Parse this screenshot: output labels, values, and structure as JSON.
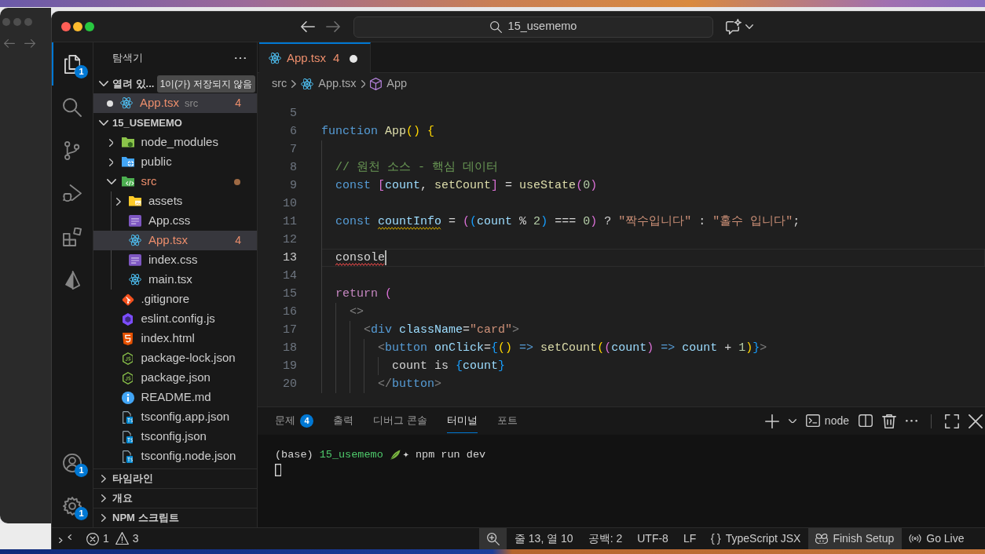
{
  "window": {
    "search": "15_usememo"
  },
  "activity_bar": {
    "top": [
      {
        "kind": "files",
        "selected": true,
        "badge": "1"
      },
      {
        "kind": "search",
        "selected": false
      },
      {
        "kind": "branch",
        "selected": false
      },
      {
        "kind": "debug",
        "selected": false
      },
      {
        "kind": "extensions",
        "selected": false
      },
      {
        "kind": "prism",
        "selected": false
      }
    ],
    "bottom": [
      {
        "kind": "account",
        "selected": false,
        "badge": "1"
      },
      {
        "kind": "gear",
        "selected": false,
        "badge": "1"
      }
    ]
  },
  "sidebar": {
    "title": "탐색기",
    "open_editors": {
      "label": "열려 있...",
      "expanded": true,
      "badge": "1이(가) 저장되지 않음",
      "items": [
        {
          "kind": "react",
          "name": "App.tsx",
          "description": "src",
          "problems": "4",
          "dirty": true,
          "error": true,
          "selected": true
        }
      ]
    },
    "project": {
      "label": "15_USEMEMO",
      "expanded": true,
      "items": [
        {
          "kind": "modules",
          "name": "node_modules",
          "expanded": false,
          "selected": false,
          "error": false,
          "dot": false
        },
        {
          "kind": "web",
          "name": "public",
          "expanded": false,
          "selected": false,
          "error": false,
          "dot": false
        },
        {
          "kind": "source",
          "name": "src",
          "expanded": true,
          "selected": false,
          "error": true,
          "dot": true,
          "children": [
            {
              "kind": "assets",
              "name": "assets",
              "expanded": false,
              "selected": false,
              "error": false,
              "dot": false
            },
            {
              "kind": "css",
              "name": "App.css",
              "selected": false,
              "error": false,
              "dot": false
            },
            {
              "kind": "react",
              "name": "App.tsx",
              "problems": "4",
              "selected": true,
              "error": true,
              "dot": false
            },
            {
              "kind": "css",
              "name": "index.css",
              "selected": false,
              "error": false,
              "dot": false
            },
            {
              "kind": "react",
              "name": "main.tsx",
              "selected": false,
              "error": false,
              "dot": false
            }
          ]
        },
        {
          "kind": "git",
          "name": ".gitignore",
          "selected": false,
          "error": false,
          "dot": false
        },
        {
          "kind": "eslint",
          "name": "eslint.config.js",
          "selected": false,
          "error": false,
          "dot": false
        },
        {
          "kind": "html",
          "name": "index.html",
          "selected": false,
          "error": false,
          "dot": false
        },
        {
          "kind": "js",
          "name": "package-lock.json",
          "selected": false,
          "error": false,
          "dot": false
        },
        {
          "kind": "js",
          "name": "package.json",
          "selected": false,
          "error": false,
          "dot": false
        },
        {
          "kind": "info",
          "name": "README.md",
          "selected": false,
          "error": false,
          "dot": false
        },
        {
          "kind": "typescript",
          "name": "tsconfig.app.json",
          "selected": false,
          "error": false,
          "dot": false
        },
        {
          "kind": "typescript",
          "name": "tsconfig.json",
          "selected": false,
          "error": false,
          "dot": false
        },
        {
          "kind": "typescript",
          "name": "tsconfig.node.json",
          "selected": false,
          "error": false,
          "dot": false
        }
      ]
    },
    "sections": [
      {
        "label": "타임라인",
        "expanded": false
      },
      {
        "label": "개요",
        "expanded": false
      },
      {
        "label": "NPM 스크립트",
        "expanded": false
      }
    ]
  },
  "editor": {
    "tabs": [
      {
        "kind": "react",
        "label": "App.tsx",
        "problems": "4",
        "dirty": true,
        "error": true,
        "selected": true
      }
    ],
    "breadcrumbs": [
      {
        "kind": "folder",
        "text": "src"
      },
      {
        "kind": "react",
        "text": "App.tsx"
      },
      {
        "kind": "symbol",
        "text": "App"
      }
    ],
    "lines": [
      {
        "number": "5",
        "current": false
      },
      {
        "number": "6",
        "current": false,
        "tokens": [
          {
            "text": "function ",
            "kind": "keyword"
          },
          {
            "text": "App",
            "kind": "function"
          },
          {
            "text": "()",
            "kind": "bracket1"
          },
          {
            "text": " {",
            "kind": "bracket1"
          }
        ]
      },
      {
        "number": "7",
        "current": false
      },
      {
        "number": "8",
        "current": false,
        "tokens": [
          {
            "text": "  // 원천 소스 - 핵심 데이터",
            "kind": "comment"
          }
        ]
      },
      {
        "number": "9",
        "current": false,
        "tokens": [
          {
            "text": "  const ",
            "kind": "keyword"
          },
          {
            "text": "[",
            "kind": "bracket2"
          },
          {
            "text": "count",
            "kind": "variable"
          },
          {
            "text": ", ",
            "kind": "plain"
          },
          {
            "text": "setCount",
            "kind": "function"
          },
          {
            "text": "]",
            "kind": "bracket2"
          },
          {
            "text": " = ",
            "kind": "plain"
          },
          {
            "text": "useState",
            "kind": "function"
          },
          {
            "text": "(",
            "kind": "bracket2"
          },
          {
            "text": "0",
            "kind": "number"
          },
          {
            "text": ")",
            "kind": "bracket2"
          }
        ]
      },
      {
        "number": "10",
        "current": false
      },
      {
        "number": "11",
        "current": false,
        "tokens": [
          {
            "text": "  const ",
            "kind": "keyword"
          },
          {
            "text": "countInfo",
            "kind": "variable",
            "warning": true
          },
          {
            "text": " = ",
            "kind": "plain"
          },
          {
            "text": "(",
            "kind": "bracket2"
          },
          {
            "text": "(",
            "kind": "bracket3"
          },
          {
            "text": "count",
            "kind": "variable"
          },
          {
            "text": " % ",
            "kind": "plain"
          },
          {
            "text": "2",
            "kind": "number"
          },
          {
            "text": ")",
            "kind": "bracket3"
          },
          {
            "text": " === ",
            "kind": "plain"
          },
          {
            "text": "0",
            "kind": "number"
          },
          {
            "text": ")",
            "kind": "bracket2"
          },
          {
            "text": " ? ",
            "kind": "plain"
          },
          {
            "text": "\"짝수입니다\"",
            "kind": "string"
          },
          {
            "text": " : ",
            "kind": "plain"
          },
          {
            "text": "\"홀수 입니다\"",
            "kind": "string"
          },
          {
            "text": ";",
            "kind": "plain"
          }
        ]
      },
      {
        "number": "12",
        "current": false
      },
      {
        "number": "13",
        "current": true,
        "tokens": [
          {
            "text": "  console",
            "kind": "plain",
            "error": true
          }
        ]
      },
      {
        "number": "14",
        "current": false
      },
      {
        "number": "15",
        "current": false,
        "tokens": [
          {
            "text": "  return ",
            "kind": "control"
          },
          {
            "text": "(",
            "kind": "bracket2"
          }
        ]
      },
      {
        "number": "16",
        "current": false,
        "tokens": [
          {
            "text": "    <>",
            "kind": "tag"
          }
        ]
      },
      {
        "number": "17",
        "current": false,
        "tokens": [
          {
            "text": "      <",
            "kind": "tag"
          },
          {
            "text": "div ",
            "kind": "keyword"
          },
          {
            "text": "className",
            "kind": "variable"
          },
          {
            "text": "=",
            "kind": "plain"
          },
          {
            "text": "\"card\"",
            "kind": "string"
          },
          {
            "text": ">",
            "kind": "tag"
          }
        ]
      },
      {
        "number": "18",
        "current": false,
        "tokens": [
          {
            "text": "        <",
            "kind": "tag"
          },
          {
            "text": "button ",
            "kind": "keyword"
          },
          {
            "text": "onClick",
            "kind": "variable"
          },
          {
            "text": "=",
            "kind": "plain"
          },
          {
            "text": "{",
            "kind": "bracket3"
          },
          {
            "text": "()",
            "kind": "bracket1"
          },
          {
            "text": " => ",
            "kind": "keyword"
          },
          {
            "text": "setCount",
            "kind": "function"
          },
          {
            "text": "(",
            "kind": "bracket1"
          },
          {
            "text": "(",
            "kind": "bracket2"
          },
          {
            "text": "count",
            "kind": "variable"
          },
          {
            "text": ")",
            "kind": "bracket2"
          },
          {
            "text": " => ",
            "kind": "keyword"
          },
          {
            "text": "count",
            "kind": "variable"
          },
          {
            "text": " + ",
            "kind": "plain"
          },
          {
            "text": "1",
            "kind": "number"
          },
          {
            "text": ")",
            "kind": "bracket1"
          },
          {
            "text": "}",
            "kind": "bracket3"
          },
          {
            "text": ">",
            "kind": "tag"
          }
        ]
      },
      {
        "number": "19",
        "current": false,
        "tokens": [
          {
            "text": "          count is ",
            "kind": "plain"
          },
          {
            "text": "{",
            "kind": "bracket3"
          },
          {
            "text": "count",
            "kind": "variable"
          },
          {
            "text": "}",
            "kind": "bracket3"
          }
        ]
      },
      {
        "number": "20",
        "current": false,
        "tokens": [
          {
            "text": "        </",
            "kind": "tag"
          },
          {
            "text": "button",
            "kind": "keyword"
          },
          {
            "text": ">",
            "kind": "tag"
          }
        ]
      }
    ]
  },
  "panel": {
    "tabs": [
      {
        "label": "문제",
        "badge": "4",
        "selected": false
      },
      {
        "label": "출력",
        "selected": false
      },
      {
        "label": "디버그 콘솔",
        "selected": false
      },
      {
        "label": "터미널",
        "selected": true
      },
      {
        "label": "포트",
        "selected": false
      }
    ],
    "actions": [
      {
        "kind": "plus"
      },
      {
        "kind": "chevron"
      },
      {
        "kind": "terminal",
        "label": "node"
      },
      {
        "kind": "split"
      },
      {
        "kind": "trash"
      },
      {
        "kind": "more"
      },
      {
        "kind": "divider"
      },
      {
        "kind": "maximize"
      },
      {
        "kind": "close"
      }
    ],
    "terminal": {
      "lines": [
        {
          "segments": [
            {
              "text": "(base) ",
              "kind": "plain"
            },
            {
              "text": "15_usememo",
              "kind": "path"
            },
            {
              "kind": "leaf"
            },
            {
              "text": "✦ npm run dev",
              "kind": "plain"
            }
          ]
        }
      ],
      "cursor": true
    }
  },
  "status_bar": {
    "left": [
      {
        "kind": "remote"
      },
      {
        "kind": "problems",
        "errors": "1",
        "warnings": "3"
      }
    ],
    "right": [
      {
        "kind": "zoom",
        "highlighted": true
      },
      {
        "kind": "text",
        "text": "줄 13, 열 10",
        "highlighted": false
      },
      {
        "kind": "text",
        "text": "공백: 2",
        "highlighted": false
      },
      {
        "kind": "text",
        "text": "UTF-8",
        "highlighted": false
      },
      {
        "kind": "text",
        "text": "LF",
        "highlighted": false
      },
      {
        "kind": "language",
        "text": "TypeScript JSX",
        "highlighted": false
      },
      {
        "kind": "copilot",
        "text": "Finish Setup",
        "highlighted": true
      },
      {
        "kind": "broadcast",
        "text": "Go Live",
        "highlighted": false
      }
    ]
  }
}
